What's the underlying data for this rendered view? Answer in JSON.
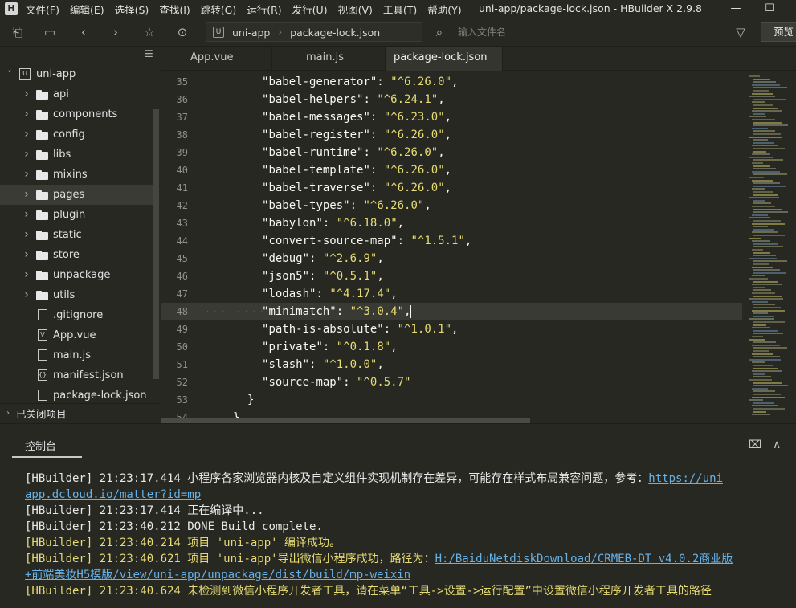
{
  "app": {
    "logo": "H",
    "window_title": "uni-app/package-lock.json - HBuilder X 2.9.8"
  },
  "menu": [
    "文件(F)",
    "编辑(E)",
    "选择(S)",
    "查找(I)",
    "跳转(G)",
    "运行(R)",
    "发行(U)",
    "视图(V)",
    "工具(T)",
    "帮助(Y)"
  ],
  "toolbar": {
    "crumb_project_icon": "U",
    "crumb_project": "uni-app",
    "crumb_file": "package-lock.json",
    "search_placeholder": "输入文件名",
    "preview_label": "预览"
  },
  "sidebar": {
    "root": {
      "label": "uni-app",
      "icon": "U"
    },
    "items": [
      {
        "label": "api",
        "type": "folder"
      },
      {
        "label": "components",
        "type": "folder"
      },
      {
        "label": "config",
        "type": "folder"
      },
      {
        "label": "libs",
        "type": "folder"
      },
      {
        "label": "mixins",
        "type": "folder"
      },
      {
        "label": "pages",
        "type": "folder",
        "selected": true
      },
      {
        "label": "plugin",
        "type": "folder"
      },
      {
        "label": "static",
        "type": "folder"
      },
      {
        "label": "store",
        "type": "folder"
      },
      {
        "label": "unpackage",
        "type": "folder"
      },
      {
        "label": "utils",
        "type": "folder"
      },
      {
        "label": ".gitignore",
        "type": "file",
        "icon": ""
      },
      {
        "label": "App.vue",
        "type": "file",
        "icon": "V"
      },
      {
        "label": "main.js",
        "type": "file",
        "icon": ""
      },
      {
        "label": "manifest.json",
        "type": "file",
        "icon": "{}"
      },
      {
        "label": "package-lock.json",
        "type": "file",
        "icon": ""
      }
    ],
    "closed_projects": "已关闭项目"
  },
  "tabs": [
    {
      "label": "App.vue",
      "active": false
    },
    {
      "label": "main.js",
      "active": false
    },
    {
      "label": "package-lock.json",
      "active": true
    }
  ],
  "editor": {
    "lines": [
      {
        "n": "35",
        "key": "babel-generator",
        "val": "^6.26.0",
        "comma": true
      },
      {
        "n": "36",
        "key": "babel-helpers",
        "val": "^6.24.1",
        "comma": true
      },
      {
        "n": "37",
        "key": "babel-messages",
        "val": "^6.23.0",
        "comma": true
      },
      {
        "n": "38",
        "key": "babel-register",
        "val": "^6.26.0",
        "comma": true
      },
      {
        "n": "39",
        "key": "babel-runtime",
        "val": "^6.26.0",
        "comma": true
      },
      {
        "n": "40",
        "key": "babel-template",
        "val": "^6.26.0",
        "comma": true
      },
      {
        "n": "41",
        "key": "babel-traverse",
        "val": "^6.26.0",
        "comma": true
      },
      {
        "n": "42",
        "key": "babel-types",
        "val": "^6.26.0",
        "comma": true
      },
      {
        "n": "43",
        "key": "babylon",
        "val": "^6.18.0",
        "comma": true
      },
      {
        "n": "44",
        "key": "convert-source-map",
        "val": "^1.5.1",
        "comma": true
      },
      {
        "n": "45",
        "key": "debug",
        "val": "^2.6.9",
        "comma": true
      },
      {
        "n": "46",
        "key": "json5",
        "val": "^0.5.1",
        "comma": true
      },
      {
        "n": "47",
        "key": "lodash",
        "val": "^4.17.4",
        "comma": true
      },
      {
        "n": "48",
        "key": "minimatch",
        "val": "^3.0.4",
        "comma": true,
        "current": true
      },
      {
        "n": "49",
        "key": "path-is-absolute",
        "val": "^1.0.1",
        "comma": true
      },
      {
        "n": "50",
        "key": "private",
        "val": "^0.1.8",
        "comma": true
      },
      {
        "n": "51",
        "key": "slash",
        "val": "^1.0.0",
        "comma": true
      },
      {
        "n": "52",
        "key": "source-map",
        "val": "^0.5.7",
        "comma": false
      },
      {
        "n": "53",
        "brace": "}"
      },
      {
        "n": "54",
        "brace": "},"
      }
    ]
  },
  "console": {
    "tab_label": "控制台",
    "logs": [
      {
        "color": "white",
        "prefix": "[HBuilder] 21:23:17.414 ",
        "text": "小程序各家浏览器内核及自定义组件实现机制存在差异，可能存在样式布局兼容问题，参考：",
        "link": "https://uni"
      },
      {
        "color": "white",
        "prefix": "",
        "text": "",
        "link": "app.dcloud.io/matter?id=mp"
      },
      {
        "color": "white",
        "prefix": "[HBuilder] 21:23:17.414 ",
        "text": "正在编译中...",
        "link": ""
      },
      {
        "color": "white",
        "prefix": "[HBuilder] 21:23:40.212 ",
        "text": " DONE  Build complete.",
        "link": ""
      },
      {
        "color": "yellow",
        "prefix": "[HBuilder] 21:23:40.214 ",
        "text": "项目 'uni-app' 编译成功。",
        "link": ""
      },
      {
        "color": "yellow",
        "prefix": "[HBuilder] 21:23:40.621 ",
        "text": "项目 'uni-app'导出微信小程序成功，路径为：",
        "link": "H:/BaiduNetdiskDownload/CRMEB-DT_v4.0.2商业版"
      },
      {
        "color": "yellow",
        "prefix": "",
        "text": "",
        "link": "+前端美妆H5模版/view/uni-app/unpackage/dist/build/mp-weixin"
      },
      {
        "color": "yellow",
        "prefix": "[HBuilder] 21:23:40.624 ",
        "text": "未检测到微信小程序开发者工具，请在菜单“工具->设置->运行配置”中设置微信小程序开发者工具的路径",
        "link": ""
      }
    ]
  },
  "colors": {
    "background": "#272822",
    "string": "#e6db74",
    "link": "#66b2e8",
    "current_line": "#393a34"
  }
}
